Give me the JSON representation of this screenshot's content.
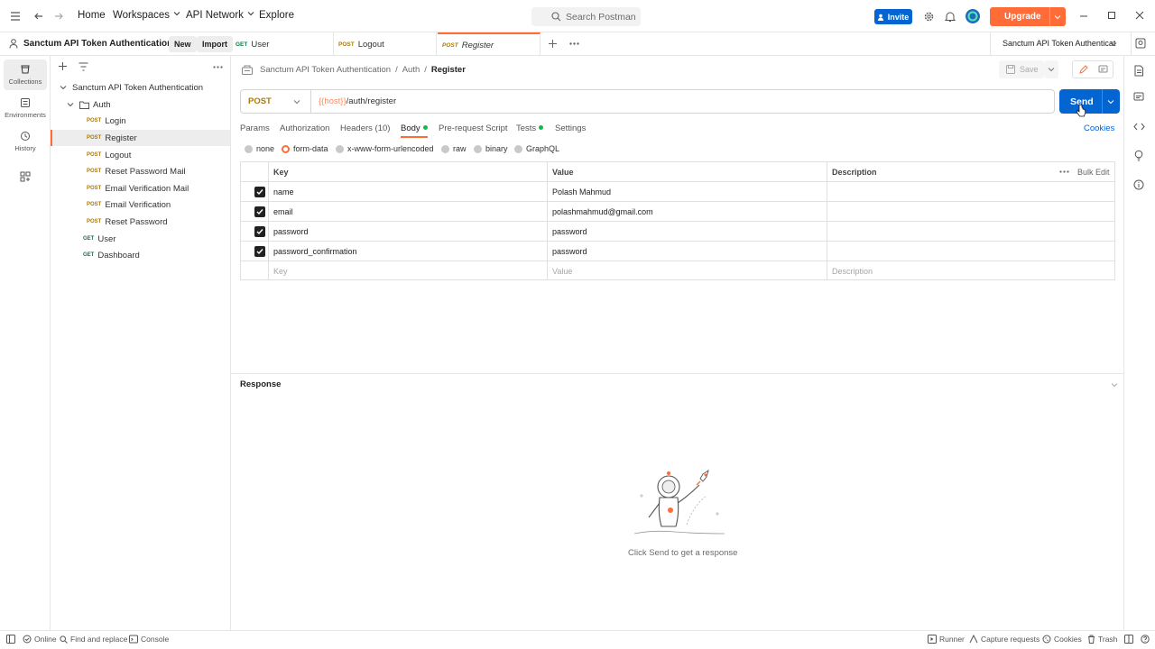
{
  "topbar": {
    "nav": [
      "Home",
      "Workspaces",
      "API Network",
      "Explore"
    ],
    "search_placeholder": "Search Postman",
    "invite": "Invite",
    "upgrade": "Upgrade"
  },
  "workspace": {
    "name": "Sanctum API Token Authentication",
    "new": "New",
    "import": "Import",
    "env_selector": "Sanctum API Token Authenticat"
  },
  "tabs": [
    {
      "method": "GET",
      "name": "User"
    },
    {
      "method": "POST",
      "name": "Logout"
    },
    {
      "method": "POST",
      "name": "Register"
    }
  ],
  "rail": [
    "Collections",
    "Environments",
    "History"
  ],
  "sidebar": {
    "collection": "Sanctum API Token Authentication",
    "folder": "Auth",
    "items": [
      {
        "method": "POST",
        "name": "Login"
      },
      {
        "method": "POST",
        "name": "Register"
      },
      {
        "method": "POST",
        "name": "Logout"
      },
      {
        "method": "POST",
        "name": "Reset Password Mail"
      },
      {
        "method": "POST",
        "name": "Email Verification Mail"
      },
      {
        "method": "POST",
        "name": "Email Verification"
      },
      {
        "method": "POST",
        "name": "Reset Password"
      },
      {
        "method": "GET",
        "name": "User"
      },
      {
        "method": "GET",
        "name": "Dashboard"
      }
    ]
  },
  "request": {
    "crumbs": [
      "Sanctum API Token Authentication",
      "/",
      "Auth",
      "/",
      "Register"
    ],
    "save": "Save",
    "method": "POST",
    "url_var": "{{host}}",
    "url_path": "/auth/register",
    "send": "Send",
    "tabs": [
      "Params",
      "Authorization",
      "Headers (10)",
      "Body",
      "Pre-request Script",
      "Tests",
      "Settings"
    ],
    "cookies": "Cookies",
    "body_types": [
      "none",
      "form-data",
      "x-www-form-urlencoded",
      "raw",
      "binary",
      "GraphQL"
    ],
    "table": {
      "headers": [
        "Key",
        "Value",
        "Description"
      ],
      "bulk_edit": "Bulk Edit",
      "rows": [
        {
          "key": "name",
          "value": "Polash Mahmud"
        },
        {
          "key": "email",
          "value": "polashmahmud@gmail.com"
        },
        {
          "key": "password",
          "value": "password"
        },
        {
          "key": "password_confirmation",
          "value": "password"
        }
      ],
      "placeholders": [
        "Key",
        "Value",
        "Description"
      ]
    }
  },
  "response": {
    "title": "Response",
    "empty": "Click Send to get a response"
  },
  "status": {
    "online": "Online",
    "find": "Find and replace",
    "console": "Console",
    "runner": "Runner",
    "capture": "Capture requests",
    "cookies": "Cookies",
    "trash": "Trash"
  },
  "colors": {
    "accent": "#ff6c37",
    "primary": "#0265d2",
    "get": "#0c7a40",
    "post": "#ad7a03"
  }
}
